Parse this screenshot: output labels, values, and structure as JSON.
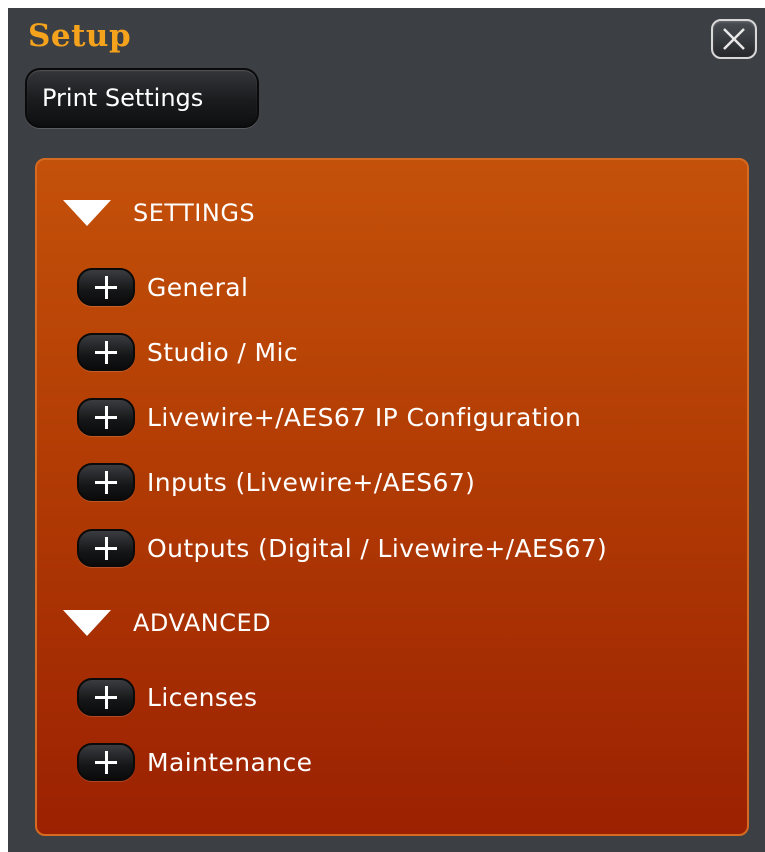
{
  "window": {
    "title": "Setup",
    "close_icon": "close-x-icon",
    "title_color": "#f5a21c",
    "background": "#3c3f44"
  },
  "toolbar": {
    "print_settings_label": "Print Settings"
  },
  "panel": {
    "accent": "#c4510a",
    "sections": [
      {
        "label": "SETTINGS",
        "expanded": true,
        "icon": "triangle-down-icon",
        "items": [
          {
            "label": "General",
            "icon": "plus-icon"
          },
          {
            "label": "Studio / Mic",
            "icon": "plus-icon"
          },
          {
            "label": "Livewire+/AES67 IP Configuration",
            "icon": "plus-icon"
          },
          {
            "label": "Inputs (Livewire+/AES67)",
            "icon": "plus-icon"
          },
          {
            "label": "Outputs (Digital / Livewire+/AES67)",
            "icon": "plus-icon"
          }
        ]
      },
      {
        "label": "ADVANCED",
        "expanded": true,
        "icon": "triangle-down-icon",
        "items": [
          {
            "label": "Licenses",
            "icon": "plus-icon"
          },
          {
            "label": "Maintenance",
            "icon": "plus-icon"
          }
        ]
      }
    ]
  }
}
